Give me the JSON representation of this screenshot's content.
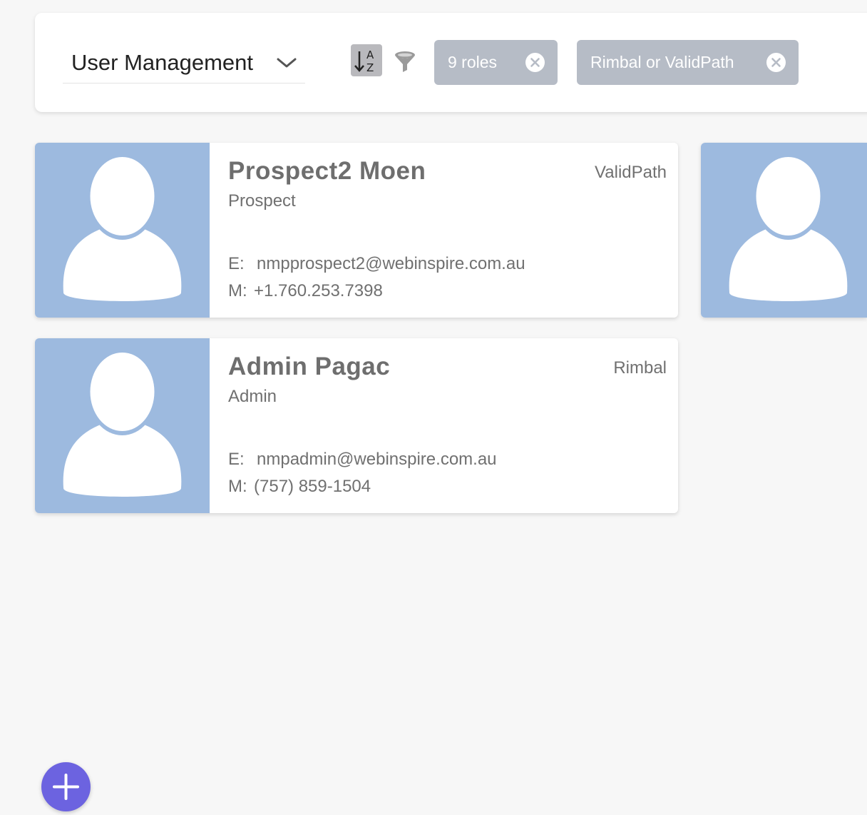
{
  "toolbar": {
    "view_select": {
      "value": "User Management"
    },
    "sort": {
      "icon": "sort-alpha-down-icon",
      "letter_top": "A",
      "letter_bottom": "Z"
    },
    "filter": {
      "icon": "funnel-icon"
    },
    "chips": [
      {
        "label": "9 roles",
        "icon": "close-circle-icon"
      },
      {
        "label": "Rimbal or ValidPath",
        "icon": "close-circle-icon"
      }
    ]
  },
  "users": [
    {
      "name": "Prospect2 Moen",
      "role": "Prospect",
      "organization": "ValidPath",
      "email_label": "E:",
      "email": "nmpprospect2@webinspire.com.au",
      "phone_label": "M:",
      "phone": "+1.760.253.7398"
    },
    {
      "name": "Admin Pagac",
      "role": "Admin",
      "organization": "Rimbal",
      "email_label": "E:",
      "email": "nmpadmin@webinspire.com.au",
      "phone_label": "M:",
      "phone": "(757) 859-1504"
    }
  ],
  "colors": {
    "avatar_bg": "#9dbadf",
    "chip_bg": "#b6bcc6",
    "fab_bg": "#6c63e0",
    "page_bg": "#f7f7f7"
  },
  "fab": {
    "icon": "plus-icon"
  }
}
